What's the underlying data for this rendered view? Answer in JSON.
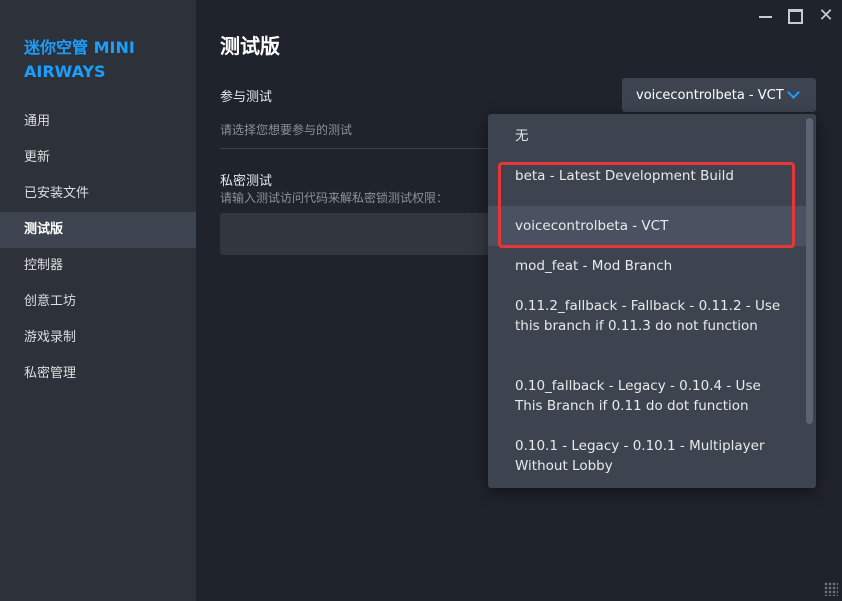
{
  "app": {
    "title": "迷你空管 MINI AIRWAYS"
  },
  "sidebar": {
    "items": [
      {
        "label": "通用"
      },
      {
        "label": "更新"
      },
      {
        "label": "已安装文件"
      },
      {
        "label": "测试版",
        "active": true
      },
      {
        "label": "控制器"
      },
      {
        "label": "创意工坊"
      },
      {
        "label": "游戏录制"
      },
      {
        "label": "私密管理"
      }
    ]
  },
  "main": {
    "title": "测试版",
    "beta_label": "参与测试",
    "beta_hint": "请选择您想要参与的测试",
    "selected_beta": "voicecontrolbeta - VCT",
    "private_label": "私密测试",
    "private_desc": "请输入测试访问代码来解私密锁测试权限：",
    "access_code_value": ""
  },
  "dropdown": {
    "options": [
      {
        "label": "无"
      },
      {
        "label": "beta - Latest Development Build"
      },
      {
        "label": "voicecontrolbeta - VCT"
      },
      {
        "label": "mod_feat - Mod Branch"
      },
      {
        "label": "0.11.2_fallback - Fallback - 0.11.2 - Use this branch if 0.11.3 do not function"
      },
      {
        "label": "0.10_fallback - Legacy - 0.10.4 - Use This Branch if 0.11 do dot function"
      },
      {
        "label": "0.10.1 - Legacy - 0.10.1 - Multiplayer Without Lobby"
      }
    ]
  },
  "colors": {
    "accent": "#1a9fff",
    "highlight": "#e5363a",
    "background": "#1f232b",
    "sidebar": "#2c313a"
  },
  "icons": [
    "minimize-icon",
    "maximize-icon",
    "close-icon",
    "chevron-down-icon",
    "resize-grip-icon"
  ]
}
